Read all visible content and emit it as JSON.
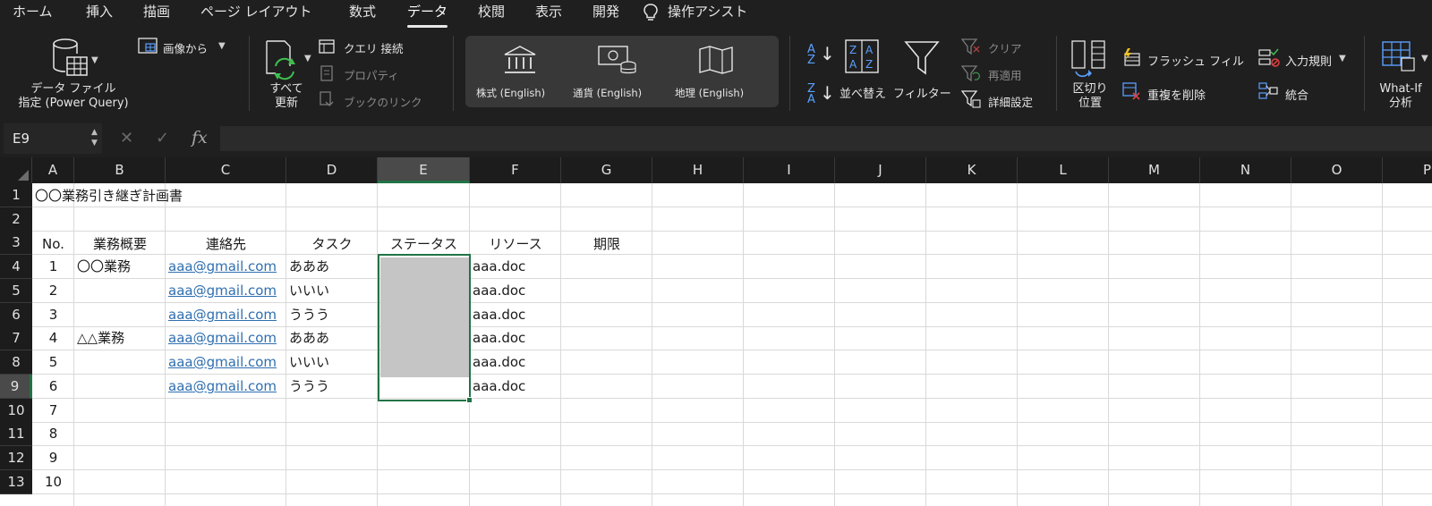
{
  "tabs": [
    "ホーム",
    "挿入",
    "描画",
    "ページ レイアウト",
    "数式",
    "データ",
    "校閲",
    "表示",
    "開発",
    "操作アシスト"
  ],
  "active_tab": "データ",
  "ribbon": {
    "get_data": [
      "データ ファイル",
      "指定 (Power Query)"
    ],
    "from_picture": "画像から",
    "refresh_all": [
      "すべて",
      "更新"
    ],
    "queries_connections": "クエリ 接続",
    "properties": "プロパティ",
    "workbook_links": "ブックのリンク",
    "data_types": [
      "株式 (English)",
      "通貨 (English)",
      "地理 (English)"
    ],
    "sort_az_icon": "sort-ascending-icon",
    "sort": "並べ替え",
    "filter": "フィルター",
    "clear": "クリア",
    "reapply": "再適用",
    "advanced": "詳細設定",
    "text_to_columns": [
      "区切り",
      "位置"
    ],
    "flash_fill": "フラッシュ フィル",
    "remove_duplicates": "重複を削除",
    "data_validation": "入力規則",
    "consolidate": "統合",
    "what_if": [
      "What-If",
      "分析"
    ]
  },
  "formula_bar": {
    "name_box": "E9",
    "cancel_icon": "✕",
    "enter_icon": "✓",
    "fx_label": "fx",
    "formula": ""
  },
  "columns": [
    "A",
    "B",
    "C",
    "D",
    "E",
    "F",
    "G",
    "H",
    "I",
    "J",
    "K",
    "L",
    "M",
    "N",
    "O",
    "P"
  ],
  "rows": [
    "1",
    "2",
    "3",
    "4",
    "5",
    "6",
    "7",
    "8",
    "9",
    "10",
    "11",
    "12",
    "13"
  ],
  "selected_cell": "E9",
  "accent_color": "#217346",
  "sheet": {
    "title": "〇〇業務引き継ぎ計画書",
    "headers": [
      "No.",
      "業務概要",
      "連絡先",
      "タスク",
      "ステータス",
      "リソース",
      "期限"
    ],
    "records": [
      {
        "no": "1",
        "summary": "〇〇業務",
        "contact": "aaa@gmail.com",
        "task": "あああ",
        "resource": "aaa.doc"
      },
      {
        "no": "2",
        "summary": "",
        "contact": "aaa@gmail.com",
        "task": "いいい",
        "resource": "aaa.doc"
      },
      {
        "no": "3",
        "summary": "",
        "contact": "aaa@gmail.com",
        "task": "ううう",
        "resource": "aaa.doc"
      },
      {
        "no": "4",
        "summary": "△△業務",
        "contact": "aaa@gmail.com",
        "task": "あああ",
        "resource": "aaa.doc"
      },
      {
        "no": "5",
        "summary": "",
        "contact": "aaa@gmail.com",
        "task": "いいい",
        "resource": "aaa.doc"
      },
      {
        "no": "6",
        "summary": "",
        "contact": "aaa@gmail.com",
        "task": "ううう",
        "resource": "aaa.doc"
      },
      {
        "no": "7",
        "summary": "",
        "contact": "",
        "task": "",
        "resource": ""
      },
      {
        "no": "8",
        "summary": "",
        "contact": "",
        "task": "",
        "resource": ""
      },
      {
        "no": "9",
        "summary": "",
        "contact": "",
        "task": "",
        "resource": ""
      },
      {
        "no": "10",
        "summary": "",
        "contact": "",
        "task": "",
        "resource": ""
      }
    ]
  }
}
